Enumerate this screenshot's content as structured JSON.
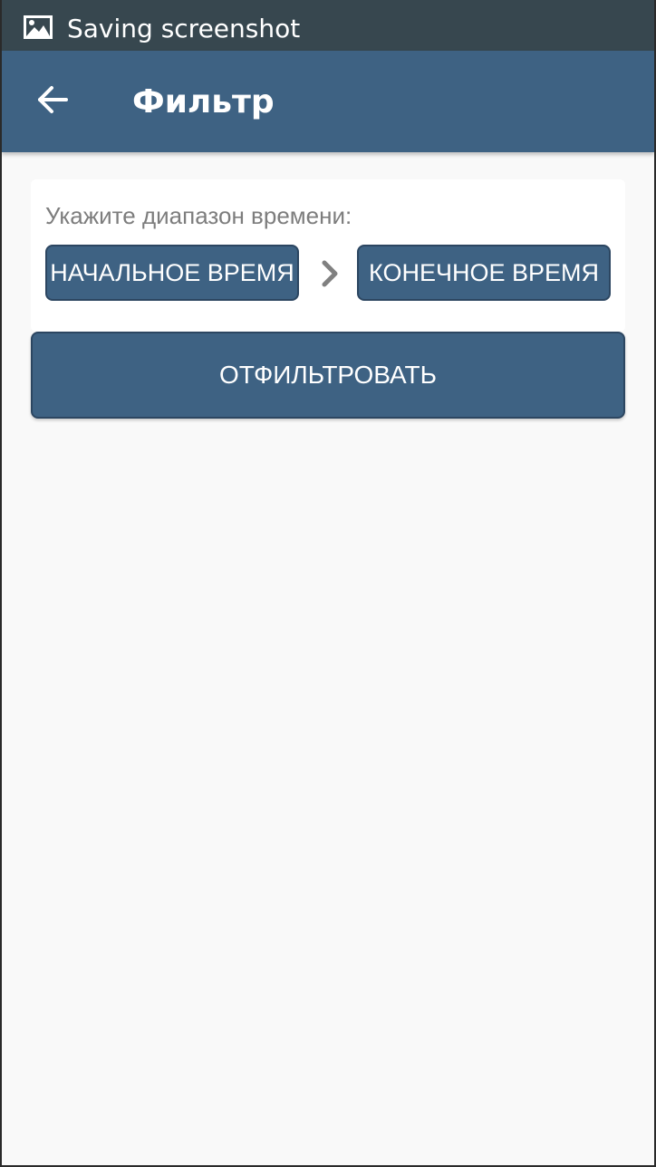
{
  "status_bar": {
    "icon": "image-icon",
    "text": "Saving screenshot"
  },
  "app_bar": {
    "back_icon": "arrow-left-icon",
    "title": "Фильтр"
  },
  "time_range": {
    "label": "Укажите диапазон времени:",
    "start_button": "НАЧАЛЬНОЕ ВРЕМЯ",
    "separator_icon": "chevron-right-icon",
    "end_button": "КОНЕЧНОЕ ВРЕМЯ"
  },
  "filter_button": "ОТФИЛЬТРОВАТЬ",
  "colors": {
    "primary": "#3e6283",
    "status_bar": "#37474f",
    "background": "#f9f9f9"
  }
}
